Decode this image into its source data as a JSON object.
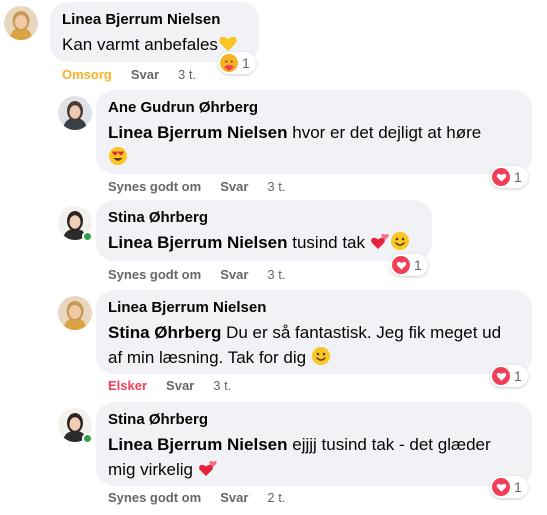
{
  "comments": [
    {
      "author": "Linea Bjerrum Nielsen",
      "text": "Kan varmt anbefales",
      "emoji": "yellow-heart",
      "reaction_type": "care",
      "reaction_count": "1",
      "actions": {
        "react": "Omsorg",
        "reply": "Svar",
        "time": "3 t."
      },
      "react_color": "#f7b125"
    },
    {
      "author": "Ane Gudrun Øhrberg",
      "mention": "Linea Bjerrum Nielsen",
      "text": " hvor er det dejligt at høre",
      "emoji": "heart-eyes",
      "reaction_type": "love",
      "reaction_count": "1",
      "actions": {
        "react": "Synes godt om",
        "reply": "Svar",
        "time": "3 t."
      }
    },
    {
      "author": "Stina Øhrberg",
      "mention": "Linea Bjerrum Nielsen",
      "text": " tusind tak ",
      "emoji": "two-hearts smile",
      "online": true,
      "reaction_type": "love",
      "reaction_count": "1",
      "actions": {
        "react": "Synes godt om",
        "reply": "Svar",
        "time": "3 t."
      }
    },
    {
      "author": "Linea Bjerrum Nielsen",
      "mention": "Stina Øhrberg",
      "text_line1": " Du er så fantastisk. Jeg fik meget ud",
      "text_line2": "af min læsning. Tak for dig ",
      "emoji": "smile",
      "reaction_type": "love",
      "reaction_count": "1",
      "actions": {
        "react": "Elsker",
        "reply": "Svar",
        "time": "3 t."
      },
      "react_color": "#f33e58"
    },
    {
      "author": "Stina Øhrberg",
      "mention": "Linea Bjerrum Nielsen",
      "text_line1": " ejjjj tusind tak - det glæder",
      "text_line2": "mig virkelig ",
      "emoji": "two-hearts",
      "online": true,
      "reaction_type": "love",
      "reaction_count": "1",
      "actions": {
        "react": "Synes godt om",
        "reply": "Svar",
        "time": "2 t."
      }
    }
  ],
  "colors": {
    "bubble": "#f0f2f5",
    "secondary_text": "#65676b",
    "love": "#f33e58",
    "care": "#f7b125",
    "online": "#31a24c"
  }
}
